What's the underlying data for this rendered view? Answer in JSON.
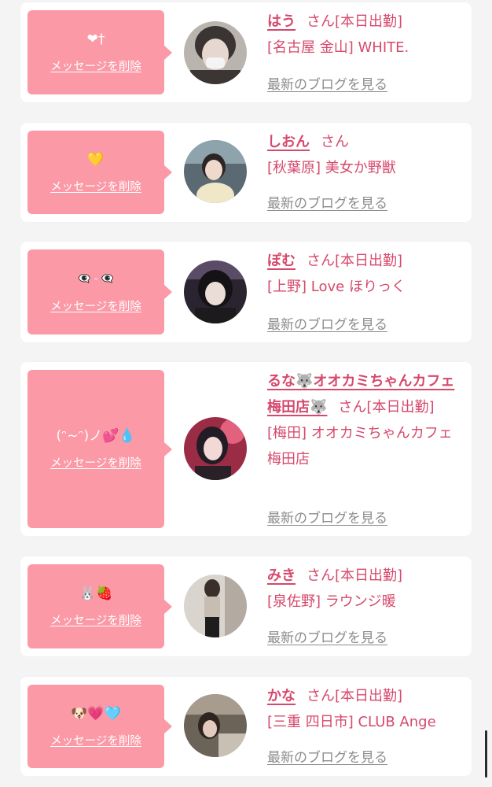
{
  "delete_label": "メッセージを削除",
  "blog_label": "最新のブログを見る",
  "colors": {
    "accent_pink": "#fb99a6",
    "name_pink": "#d6496c",
    "link_gray": "#8c8c8c",
    "background": "#f4f4f4"
  },
  "messages": [
    {
      "message": "❤︎†",
      "name": "はう",
      "suffix": "さん[本日出勤]",
      "shop": "[名古屋 金山] WHITE."
    },
    {
      "message": "💛",
      "name": "しおん",
      "suffix": "さん",
      "shop": "[秋葉原] 美女か野獣"
    },
    {
      "message": "👁‍🗨 - 👁‍🗨",
      "name": "ぽむ",
      "suffix": "さん[本日出勤]",
      "shop": "[上野] Love ほりっく"
    },
    {
      "message": "(ᵔ~ᵔ)ノ💕💧",
      "name": "るな🐺オオカミちゃんカフェ梅田店🐺",
      "suffix": "さん[本日出勤]",
      "shop": "[梅田] オオカミちゃんカフェ梅田店"
    },
    {
      "message": "🐰🍓",
      "name": "みき",
      "suffix": "さん[本日出勤]",
      "shop": "[泉佐野] ラウンジ暖"
    },
    {
      "message": "🐶💗🩵",
      "name": "かな",
      "suffix": "さん[本日出勤]",
      "shop": "[三重 四日市] CLUB Ange"
    }
  ]
}
